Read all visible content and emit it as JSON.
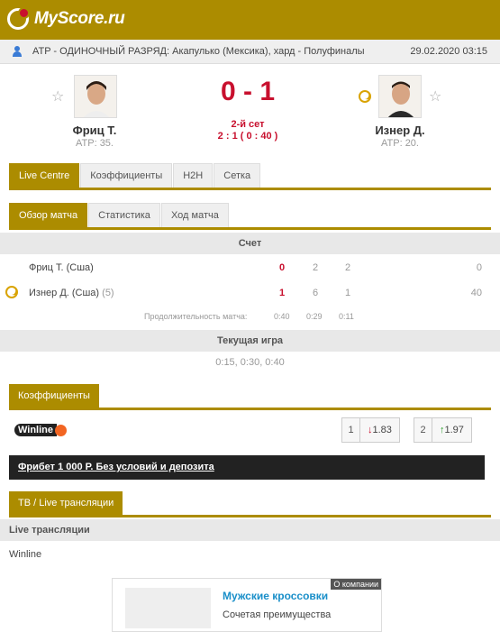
{
  "brand": {
    "logo_text": "MyScore.ru"
  },
  "breadcrumb": {
    "text": "ATP - ОДИНОЧНЫЙ РАЗРЯД: Акапулько (Мексика), хард - Полуфиналы",
    "datetime": "29.02.2020 03:15"
  },
  "match": {
    "home": {
      "name": "Фриц Т.",
      "rank": "ATP: 35."
    },
    "away": {
      "name": "Изнер Д.",
      "rank": "ATP: 20."
    },
    "score": "0 - 1",
    "status": "2-й сет",
    "set_score": "2 : 1 ( 0 : 40 )"
  },
  "tabs_main": [
    "Live Centre",
    "Коэффициенты",
    "H2H",
    "Сетка"
  ],
  "tabs_sub": [
    "Обзор матча",
    "Статистика",
    "Ход матча"
  ],
  "score_table": {
    "header": "Счет",
    "rows": [
      {
        "player": "Фриц Т. (Сша)",
        "seed": "",
        "sets": "0",
        "s1": "2",
        "s2": "2",
        "points": "0"
      },
      {
        "player": "Изнер Д. (Сша)",
        "seed": "(5)",
        "sets": "1",
        "s1": "6",
        "s2": "1",
        "points": "40"
      }
    ],
    "duration_label": "Продолжительность матча:",
    "duration": [
      "0:40",
      "0:29",
      "0:11"
    ]
  },
  "current_game": {
    "header": "Текущая игра",
    "progress": "0:15, 0:30, 0:40"
  },
  "odds": {
    "tab_label": "Коэффициенты",
    "bookmaker": "Winline",
    "home": {
      "num": "1",
      "value": "1.83",
      "trend": "down"
    },
    "away": {
      "num": "2",
      "value": "1.97",
      "trend": "up"
    },
    "promo": "Фрибет 1 000 Р. Без условий и депозита"
  },
  "tv": {
    "tab_label": "TB / Live трансляции",
    "header": "Live трансляции",
    "item": "Winline"
  },
  "ad": {
    "badge": "О компании",
    "title": "Мужские кроссовки",
    "desc": "Сочетая преимущества"
  },
  "colors": {
    "brand": "#ac8c00",
    "score_red": "#c8102e",
    "up_green": "#2a9d2a"
  }
}
